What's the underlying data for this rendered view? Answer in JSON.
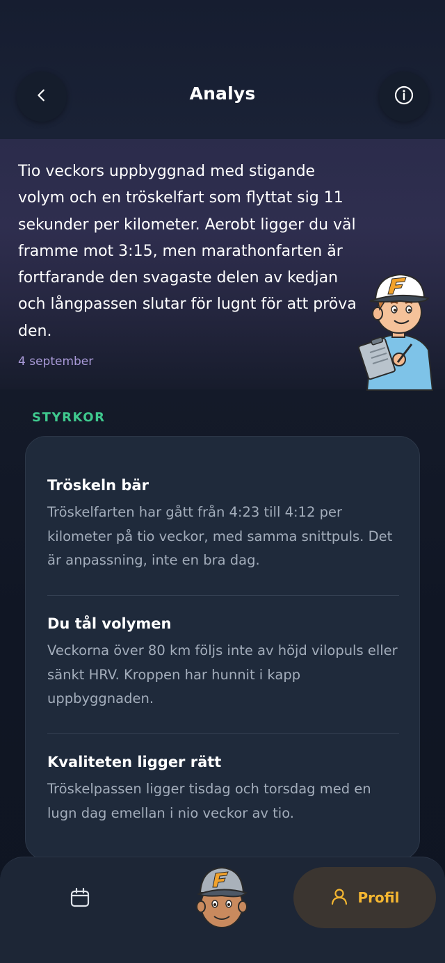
{
  "header": {
    "title": "Analys",
    "back_icon": "chevron-left-icon",
    "info_icon": "info-icon"
  },
  "hero": {
    "summary": "Tio veckors uppbyggnad med stigande volym och en tröskelfart som flyttat sig 11 sekunder per kilometer. Aerobt ligger du väl framme mot 3:15, men marathonfarten är fortfarande den svagaste delen av kedjan och långpassen slutar för lugnt för att pröva den.",
    "date": "4 september"
  },
  "strengths": {
    "label": "STYRKOR",
    "items": [
      {
        "title": "Tröskeln bär",
        "body": "Tröskelfarten har gått från 4:23 till 4:12 per kilometer på tio veckor, med samma snittpuls. Det är anpassning, inte en bra dag."
      },
      {
        "title": "Du tål volymen",
        "body": "Veckorna över 80 km följs inte av höjd vilopuls eller sänkt HRV. Kroppen har hunnit i kapp uppbyggnaden."
      },
      {
        "title": "Kvaliteten ligger rätt",
        "body": "Tröskelpassen ligger tisdag och torsdag med en lugn dag emellan i nio veckor av tio."
      }
    ]
  },
  "bottom_nav": {
    "calendar_icon": "calendar-icon",
    "profile_label": "Profil",
    "profile_icon": "user-icon"
  },
  "colors": {
    "accent_green": "#3fc98e",
    "accent_orange": "#f5b731",
    "date_purple": "#a99ad8"
  }
}
